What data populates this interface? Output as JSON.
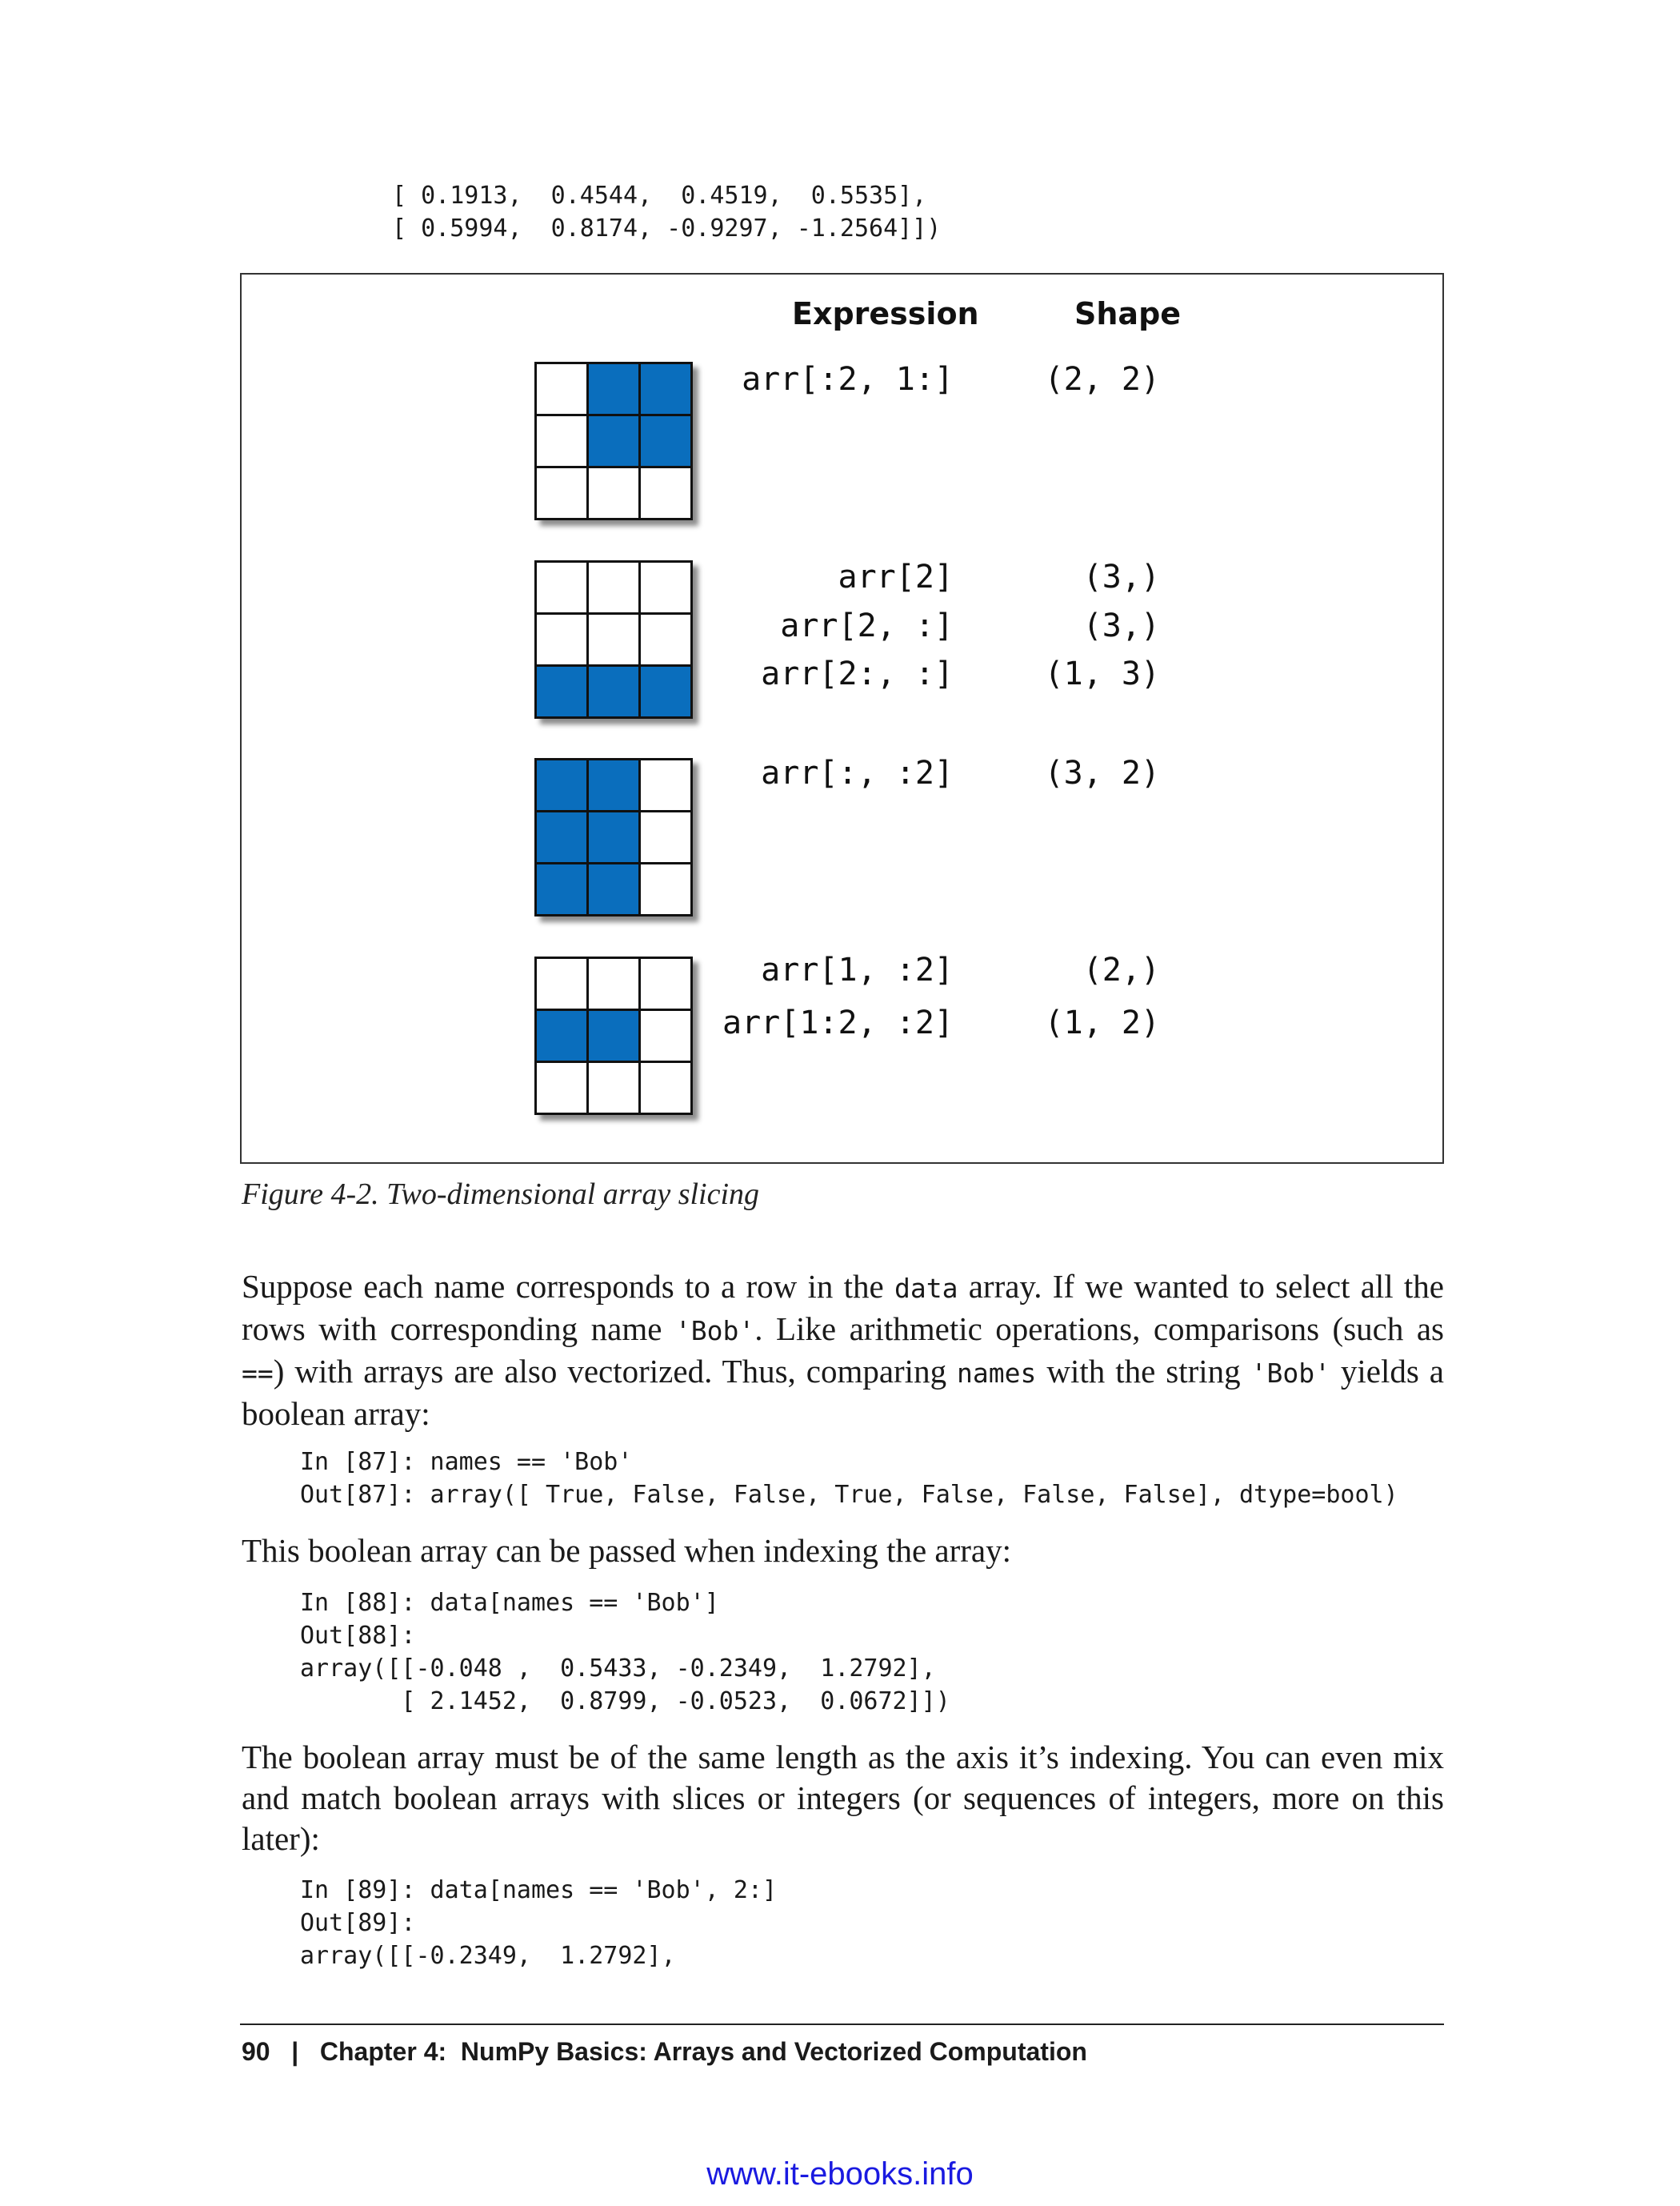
{
  "top_code": [
    "[ 0.1913,  0.4544,  0.4519,  0.5535],",
    "[ 0.5994,  0.8174, -0.9297, -1.2564]])"
  ],
  "figure": {
    "header_expression": "Expression",
    "header_shape": "Shape",
    "grids": [
      {
        "cells": [
          0,
          1,
          1,
          0,
          1,
          1,
          0,
          0,
          0
        ]
      },
      {
        "cells": [
          0,
          0,
          0,
          0,
          0,
          0,
          1,
          1,
          1
        ]
      },
      {
        "cells": [
          1,
          1,
          0,
          1,
          1,
          0,
          1,
          1,
          0
        ]
      },
      {
        "cells": [
          0,
          0,
          0,
          1,
          1,
          0,
          0,
          0,
          0
        ]
      }
    ],
    "rows": [
      {
        "expr": "arr[:2, 1:]",
        "shape": "(2, 2)"
      },
      {
        "expr": "arr[2]",
        "shape": "(3,)"
      },
      {
        "expr": "arr[2, :]",
        "shape": "(3,)"
      },
      {
        "expr": "arr[2:, :]",
        "shape": "(1, 3)"
      },
      {
        "expr": "arr[:, :2]",
        "shape": "(3, 2)"
      },
      {
        "expr": "arr[1, :2]",
        "shape": "(2,)"
      },
      {
        "expr": "arr[1:2, :2]",
        "shape": "(1, 2)"
      }
    ],
    "caption": "Figure 4-2. Two-dimensional array slicing"
  },
  "para1": {
    "t1": "Suppose each name corresponds to a row in the ",
    "c1": "data",
    "t2": " array. If we wanted to select all the rows with corresponding name ",
    "c2": "'Bob'",
    "t3": ". Like arithmetic operations, comparisons (such as ",
    "c3": "==",
    "t4": ") with arrays are also vectorized. Thus, comparing ",
    "c4": "names",
    "t5": " with the string ",
    "c5": "'Bob'",
    "t6": " yields a boolean array:"
  },
  "code1": [
    "In [87]: names == 'Bob'",
    "Out[87]: array([ True, False, False, True, False, False, False], dtype=bool)"
  ],
  "para2": "This boolean array can be passed when indexing the array:",
  "code2": [
    "In [88]: data[names == 'Bob']",
    "Out[88]:",
    "array([[-0.048 ,  0.5433, -0.2349,  1.2792],",
    "       [ 2.1452,  0.8799, -0.0523,  0.0672]])"
  ],
  "para3": "The boolean array must be of the same length as the axis it’s indexing. You can even mix and match boolean arrays with slices or integers (or sequences of integers, more on this later):",
  "code3": [
    "In [89]: data[names == 'Bob', 2:]",
    "Out[89]:",
    "array([[-0.2349,  1.2792],"
  ],
  "footer": {
    "page_number": "90",
    "separator": "|",
    "chapter": "Chapter 4:  NumPy Basics: Arrays and Vectorized Computation"
  },
  "site": "www.it-ebooks.info"
}
